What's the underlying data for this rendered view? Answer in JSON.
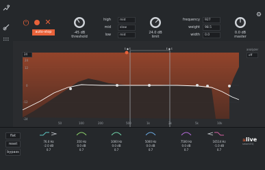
{
  "topbar": {
    "autostop_label": "auto-stop",
    "threshold": {
      "value": "-45 dB",
      "label": "threshold"
    },
    "limit": {
      "value": "24.0 dB",
      "label": "limit"
    },
    "master": {
      "value": "0.0 dB",
      "label": "master"
    },
    "bands": [
      {
        "label": "high",
        "value": "mid"
      },
      {
        "label": "mid",
        "value": "slow"
      },
      {
        "label": "low",
        "value": "mid"
      }
    ],
    "params": [
      {
        "label": "frequency",
        "value": "927"
      },
      {
        "label": "weight",
        "value": "98.5"
      },
      {
        "label": "width",
        "value": "0.0"
      }
    ]
  },
  "graph": {
    "left_ticks": [
      "24",
      "12",
      "0",
      "-12",
      "-24"
    ],
    "left_select": "24",
    "right_select_label": "analyzer",
    "right_select": "off",
    "freq_ticks": [
      "50",
      "100",
      "200",
      "500",
      "1k",
      "2k",
      "5k",
      "10k"
    ]
  },
  "bottom": {
    "buttons": [
      "flat",
      "reset",
      "bypass"
    ],
    "bands": [
      {
        "freq": "76.0 Hz",
        "gain": "-2.0 dB",
        "q": "0.7",
        "color": "#5fc9c4"
      },
      {
        "freq": "350 Hz",
        "gain": "0.0 dB",
        "q": "0.7",
        "color": "#8bd06a"
      },
      {
        "freq": "1000 Hz",
        "gain": "0.0 dB",
        "q": "0.7",
        "color": "#6fd2a8"
      },
      {
        "freq": "5000 Hz",
        "gain": "0.0 dB",
        "q": "0.7",
        "color": "#6aa9e0"
      },
      {
        "freq": "7500 Hz",
        "gain": "0.0 dB",
        "q": "0.7",
        "color": "#b36ad8"
      },
      {
        "freq": "16514 Hz",
        "gain": "-1.0 dB",
        "q": "0.7",
        "color": "#d35fa0"
      }
    ],
    "logo_main": "live",
    "logo_sub": "smart:EQ"
  },
  "colors": {
    "accent": "#e8623a",
    "curve": "#ffffff"
  }
}
